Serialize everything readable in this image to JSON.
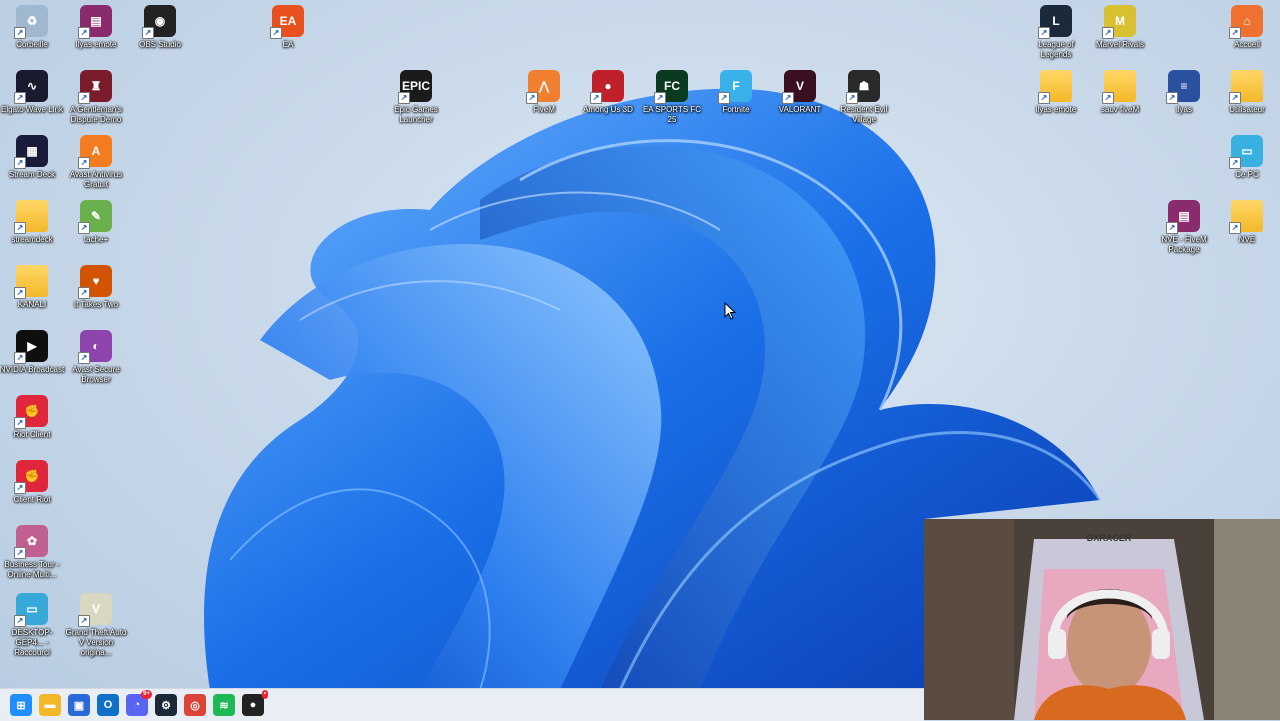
{
  "desktop": {
    "icons_left": [
      {
        "label": "Corbeille",
        "icon": "recycle-bin-icon",
        "color": "#9fb8d0",
        "glyph": "♻"
      },
      {
        "label": "Ilyas emote",
        "icon": "winrar-icon",
        "color": "#8a2b6e",
        "glyph": "▤"
      },
      {
        "label": "OBS Studio",
        "icon": "obs-icon",
        "color": "#222222",
        "glyph": "◉"
      },
      {
        "label": "EA",
        "icon": "ea-icon",
        "color": "#e8501e",
        "glyph": "EA"
      },
      {
        "label": "Elgato Wave Link",
        "icon": "wave-link-icon",
        "color": "#1a1a2e",
        "glyph": "∿"
      },
      {
        "label": "A Gentleman's Dispute Demo",
        "icon": "gentleman-hat-icon",
        "color": "#7a1c2c",
        "glyph": "♜"
      },
      {
        "label": "Stream Deck",
        "icon": "stream-deck-icon",
        "color": "#1a1a3a",
        "glyph": "▦"
      },
      {
        "label": "Avast Antivirus Gratuit",
        "icon": "avast-icon",
        "color": "#f47b20",
        "glyph": "A"
      },
      {
        "label": "streamdeck",
        "icon": "folder-icon",
        "color": "#f3b82a",
        "glyph": ""
      },
      {
        "label": "tache+",
        "icon": "notepad-icon",
        "color": "#6ab04c",
        "glyph": "✎"
      },
      {
        "label": "KANALI",
        "icon": "folder-icon",
        "color": "#f3b82a",
        "glyph": ""
      },
      {
        "label": "It Takes Two",
        "icon": "it-takes-two-icon",
        "color": "#d35400",
        "glyph": "♥"
      },
      {
        "label": "NVIDIA Broadcast",
        "icon": "nvidia-icon",
        "color": "#0f0f0f",
        "glyph": "▶"
      },
      {
        "label": "Avast Secure Browser",
        "icon": "avast-browser-icon",
        "color": "#8e44ad",
        "glyph": "◐"
      },
      {
        "label": "Riot Client",
        "icon": "riot-icon",
        "color": "#e0263a",
        "glyph": "✊"
      },
      {
        "label": "Client Riot",
        "icon": "riot-icon",
        "color": "#e0263a",
        "glyph": "✊"
      },
      {
        "label": "Business Tour - Online Multi...",
        "icon": "business-tour-icon",
        "color": "#c06090",
        "glyph": "✿"
      },
      {
        "label": "DESKTOP-GEP4... - Raccourci",
        "icon": "monitor-icon",
        "color": "#38a8d8",
        "glyph": "▭"
      },
      {
        "label": "Grand Theft Auto V Version origina...",
        "icon": "gta-v-icon",
        "color": "#d8d8c0",
        "glyph": "V"
      }
    ],
    "icons_top": [
      {
        "label": "Epic Games Launcher",
        "icon": "epic-games-icon",
        "color": "#1b1b1b",
        "glyph": "EPIC"
      },
      {
        "label": "FiveM",
        "icon": "fivem-icon",
        "color": "#f08030",
        "glyph": "⋀"
      },
      {
        "label": "Among Us 3D",
        "icon": "among-us-icon",
        "color": "#c0202a",
        "glyph": "●"
      },
      {
        "label": "EA SPORTS FC 25",
        "icon": "fc25-icon",
        "color": "#0a3a20",
        "glyph": "FC"
      },
      {
        "label": "Fortnite",
        "icon": "fortnite-icon",
        "color": "#3ab0e8",
        "glyph": "F"
      },
      {
        "label": "VALORANT",
        "icon": "valorant-icon",
        "color": "#3a1020",
        "glyph": "V"
      },
      {
        "label": "Resident Evil Village",
        "icon": "re-village-icon",
        "color": "#2a2a2a",
        "glyph": "☗"
      }
    ],
    "icons_right": [
      {
        "label": "League of Legends",
        "icon": "league-icon",
        "color": "#1a2a3a",
        "glyph": "L"
      },
      {
        "label": "Marvel Rivals",
        "icon": "marvel-rivals-icon",
        "color": "#d8c030",
        "glyph": "M"
      },
      {
        "label": "Accueil",
        "icon": "home-icon",
        "color": "#f07030",
        "glyph": "⌂"
      },
      {
        "label": "ilyas emote",
        "icon": "folder-icon",
        "color": "#f3b82a",
        "glyph": ""
      },
      {
        "label": "sauv fiveM",
        "icon": "folder-icon",
        "color": "#f3b82a",
        "glyph": ""
      },
      {
        "label": "ilyas",
        "icon": "document-icon",
        "color": "#2a50a0",
        "glyph": "≡"
      },
      {
        "label": "Utilisateur",
        "icon": "folder-icon",
        "color": "#f3b82a",
        "glyph": ""
      },
      {
        "label": "Ce PC",
        "icon": "this-pc-icon",
        "color": "#38b0e0",
        "glyph": "▭"
      },
      {
        "label": "NVE - FiveM Package",
        "icon": "winrar-icon",
        "color": "#8a2b6e",
        "glyph": "▤"
      },
      {
        "label": "NVE",
        "icon": "folder-icon",
        "color": "#f3b82a",
        "glyph": ""
      }
    ]
  },
  "taskbar": {
    "items": [
      {
        "name": "start",
        "icon": "windows-start-icon",
        "color": "#1f8fff",
        "glyph": "⊞"
      },
      {
        "name": "explorer",
        "icon": "file-explorer-icon",
        "color": "#f3b82a",
        "glyph": "▬"
      },
      {
        "name": "store",
        "icon": "store-icon",
        "color": "#2a6ad8",
        "glyph": "▣"
      },
      {
        "name": "outlook",
        "icon": "outlook-icon",
        "color": "#1070c8",
        "glyph": "O"
      },
      {
        "name": "discord",
        "icon": "discord-icon",
        "color": "#5865f2",
        "glyph": "◔",
        "badge": "9+"
      },
      {
        "name": "steam",
        "icon": "steam-icon",
        "color": "#1b2838",
        "glyph": "⚙"
      },
      {
        "name": "chrome",
        "icon": "chrome-icon",
        "color": "#db4437",
        "glyph": "◎"
      },
      {
        "name": "spotify",
        "icon": "spotify-icon",
        "color": "#1db954",
        "glyph": "≋"
      },
      {
        "name": "recording",
        "icon": "recording-app-icon",
        "color": "#222222",
        "glyph": "●",
        "badge": "•"
      }
    ]
  },
  "webcam": {
    "chair_brand": "DXRACER"
  }
}
